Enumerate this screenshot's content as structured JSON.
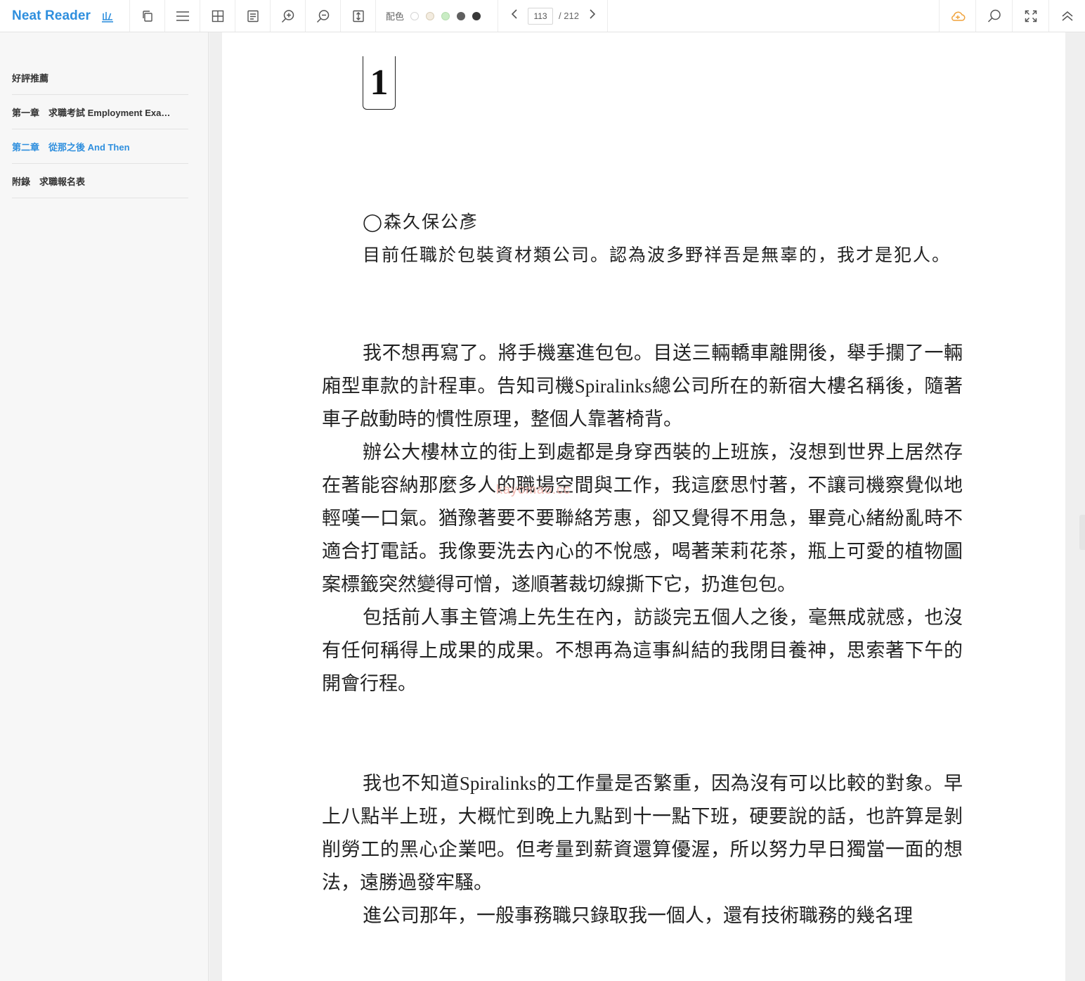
{
  "app": {
    "name": "Neat Reader"
  },
  "toolbar": {
    "theme_label": "配色",
    "theme_swatches": [
      "#ffffff",
      "#f3ece0",
      "#c9ecc4",
      "#5f5f5f",
      "#383838"
    ],
    "page_current": "113",
    "page_total": "/ 212",
    "icons": [
      "bookshelf-icon",
      "copy-icon",
      "menu-icon",
      "grid-icon",
      "notes-icon",
      "zoom-in-icon",
      "zoom-out-icon",
      "fit-height-icon",
      "prev-page-icon",
      "next-page-icon",
      "cloud-sync-icon",
      "search-icon",
      "fullscreen-icon",
      "collapse-icon"
    ],
    "cloud_color": "#f0a23a",
    "accent": "#2f8fde"
  },
  "sidebar": {
    "items": [
      {
        "label": "好評推薦",
        "active": false
      },
      {
        "label": "第一章　求職考試 Employment Exa…",
        "active": false
      },
      {
        "label": "第二章　從那之後 And Then",
        "active": true
      },
      {
        "label": "附錄　求職報名表",
        "active": false
      }
    ]
  },
  "page": {
    "chapter_number": "1",
    "author_line": "◯森久保公彥",
    "intro": "目前任職於包裝資材類公司。認為波多野祥吾是無辜的，我才是犯人。",
    "paragraphs_a": [
      "我不想再寫了。將手機塞進包包。目送三輛轎車離開後，舉手攔了一輛廂型車款的計程車。告知司機Spiralinks總公司所在的新宿大樓名稱後，隨著車子啟動時的慣性原理，整個人靠著椅背。",
      "辦公大樓林立的街上到處都是身穿西裝的上班族，沒想到世界上居然存在著能容納那麼多人的職場空間與工作，我這麼思忖著，不讓司機察覺似地輕嘆一口氣。猶豫著要不要聯絡芳惠，卻又覺得不用急，畢竟心緒紛亂時不適合打電話。我像要洗去內心的不悅感，喝著茉莉花茶，瓶上可愛的植物圖案標籤突然變得可憎，遂順著裁切線撕下它，扔進包包。",
      "包括前人事主管鴻上先生在內，訪談完五個人之後，毫無成就感，也沒有任何稱得上成果的成果。不想再為這事糾結的我閉目養神，思索著下午的開會行程。"
    ],
    "paragraphs_b": [
      "我也不知道Spiralinks的工作量是否繁重，因為沒有可以比較的對象。早上八點半上班，大概忙到晚上九點到十一點下班，硬要說的話，也許算是剝削勞工的黑心企業吧。但考量到薪資還算優渥，所以努力早日獨當一面的想法，遠勝過發牢騷。",
      "進公司那年，一般事務職只錄取我一個人，還有技術職務的幾名理"
    ],
    "watermark": "kayomao.cc"
  }
}
